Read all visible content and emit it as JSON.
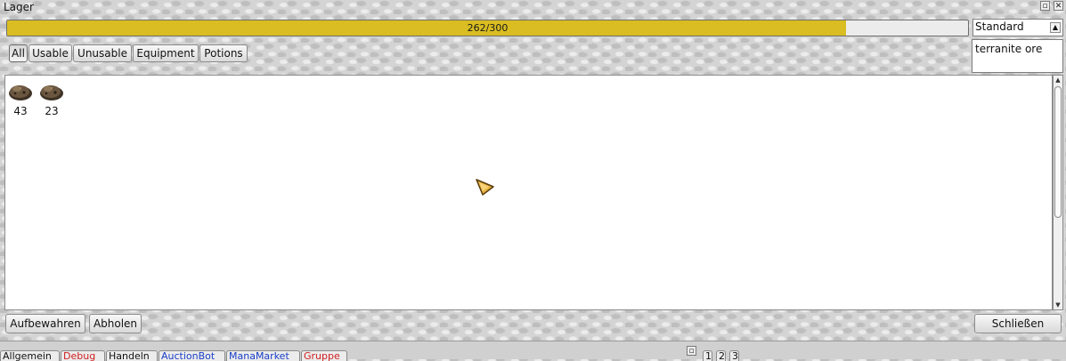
{
  "window": {
    "title": "Lager"
  },
  "capacity": {
    "text": "262/300",
    "fraction": 0.8733
  },
  "sort_select": {
    "value": "Standard"
  },
  "search": {
    "value": "terranite ore"
  },
  "filter_tabs": [
    {
      "label": "All",
      "active": true
    },
    {
      "label": "Usable",
      "active": false
    },
    {
      "label": "Unusable",
      "active": false
    },
    {
      "label": "Equipment",
      "active": false
    },
    {
      "label": "Potions",
      "active": false
    }
  ],
  "items": [
    {
      "icon": "terranite-ore-icon",
      "count": "43"
    },
    {
      "icon": "terranite-ore-icon",
      "count": "23"
    }
  ],
  "buttons": {
    "store": "Aufbewahren",
    "retrieve": "Abholen",
    "close": "Schließen"
  },
  "chat_tabs": [
    {
      "label": "Allgemein",
      "color": "#111111"
    },
    {
      "label": "Debug",
      "color": "#d02020"
    },
    {
      "label": "Handeln",
      "color": "#111111"
    },
    {
      "label": "AuctionBot",
      "color": "#1a3ec8"
    },
    {
      "label": "ManaMarket",
      "color": "#1a3ec8"
    },
    {
      "label": "Gruppe",
      "color": "#d02020"
    }
  ],
  "page_tabs": [
    "1",
    "2",
    "3"
  ]
}
